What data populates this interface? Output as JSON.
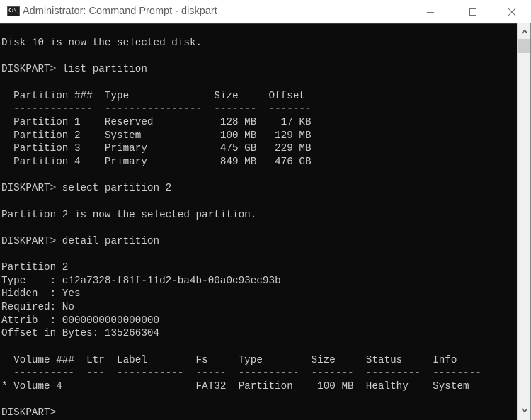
{
  "window": {
    "title": "Administrator: Command Prompt - diskpart",
    "app_icon_text": "C:\\_",
    "controls": {
      "minimize": "minimize",
      "maximize": "maximize",
      "close": "close"
    }
  },
  "console": {
    "lines": [
      "Disk 10 is now the selected disk.",
      "",
      "DISKPART> list partition",
      "",
      "  Partition ###  Type              Size     Offset",
      "  -------------  ----------------  -------  -------",
      "  Partition 1    Reserved           128 MB    17 KB",
      "  Partition 2    System             100 MB   129 MB",
      "  Partition 3    Primary            475 GB   229 MB",
      "  Partition 4    Primary            849 MB   476 GB",
      "",
      "DISKPART> select partition 2",
      "",
      "Partition 2 is now the selected partition.",
      "",
      "DISKPART> detail partition",
      "",
      "Partition 2",
      "Type    : c12a7328-f81f-11d2-ba4b-00a0c93ec93b",
      "Hidden  : Yes",
      "Required: No",
      "Attrib  : 0000000000000000",
      "Offset in Bytes: 135266304",
      "",
      "  Volume ###  Ltr  Label        Fs     Type        Size     Status     Info",
      "  ----------  ---  -----------  -----  ----------  -------  ---------  --------",
      "* Volume 4                      FAT32  Partition    100 MB  Healthy    System",
      "",
      "DISKPART> "
    ],
    "partition_table": {
      "headers": [
        "Partition ###",
        "Type",
        "Size",
        "Offset"
      ],
      "rows": [
        [
          "Partition 1",
          "Reserved",
          "128 MB",
          "17 KB"
        ],
        [
          "Partition 2",
          "System",
          "100 MB",
          "129 MB"
        ],
        [
          "Partition 3",
          "Primary",
          "475 GB",
          "229 MB"
        ],
        [
          "Partition 4",
          "Primary",
          "849 MB",
          "476 GB"
        ]
      ]
    },
    "volume_table": {
      "headers": [
        "Volume ###",
        "Ltr",
        "Label",
        "Fs",
        "Type",
        "Size",
        "Status",
        "Info"
      ],
      "rows": [
        [
          "* Volume 4",
          "",
          "",
          "FAT32",
          "Partition",
          "100 MB",
          "Healthy",
          "System"
        ]
      ]
    },
    "prompt": "DISKPART>"
  },
  "colors": {
    "console_bg": "#0c0c0c",
    "console_fg": "#cccccc",
    "titlebar_bg": "#ffffff",
    "title_fg": "#5f5f5f"
  }
}
